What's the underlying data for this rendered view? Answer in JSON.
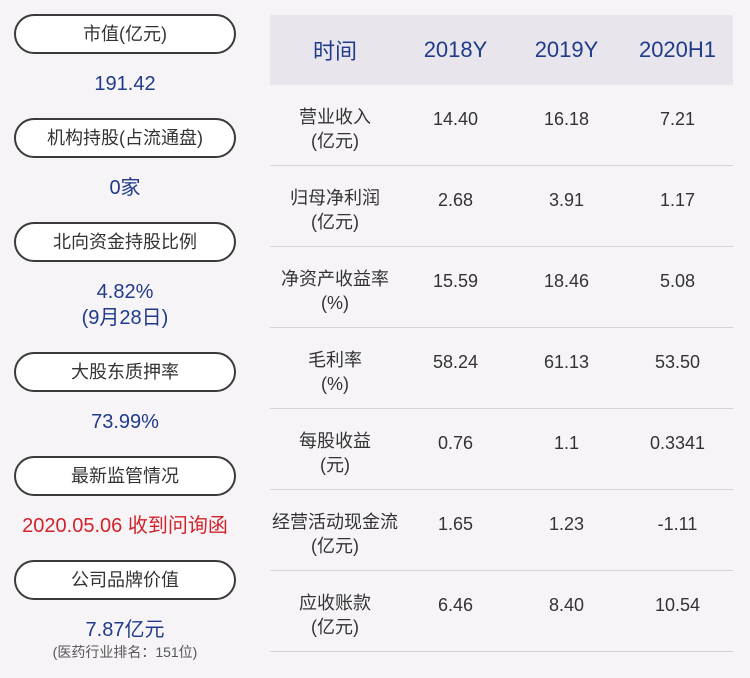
{
  "left": {
    "items": [
      {
        "label": "市值(亿元)",
        "value": "191.42"
      },
      {
        "label": "机构持股(占流通盘)",
        "value": "0家"
      },
      {
        "label": "北向资金持股比例",
        "value_line1": "4.82%",
        "value_line2": "(9月28日)"
      },
      {
        "label": "大股东质押率",
        "value": "73.99%"
      },
      {
        "label": "最新监管情况",
        "value": "2020.05.06 收到问询函"
      },
      {
        "label": "公司品牌价值",
        "value": "7.87亿元",
        "note": "(医药行业排名：151位)"
      }
    ]
  },
  "table": {
    "headers": [
      "时间",
      "2018Y",
      "2019Y",
      "2020H1"
    ],
    "rows": [
      {
        "metric_line1": "营业收入",
        "metric_line2": "(亿元)",
        "values": [
          "14.40",
          "16.18",
          "7.21"
        ]
      },
      {
        "metric_line1": "归母净利润",
        "metric_line2": "(亿元)",
        "values": [
          "2.68",
          "3.91",
          "1.17"
        ]
      },
      {
        "metric_line1": "净资产收益率",
        "metric_line2": "(%)",
        "values": [
          "15.59",
          "18.46",
          "5.08"
        ]
      },
      {
        "metric_line1": "毛利率",
        "metric_line2": "(%)",
        "values": [
          "58.24",
          "61.13",
          "53.50"
        ]
      },
      {
        "metric_line1": "每股收益",
        "metric_line2": "(元)",
        "values": [
          "0.76",
          "1.1",
          "0.3341"
        ]
      },
      {
        "metric_line1": "经营活动现金流",
        "metric_line2": "(亿元)",
        "values": [
          "1.65",
          "1.23",
          "-1.11"
        ]
      },
      {
        "metric_line1": "应收账款",
        "metric_line2": "(亿元)",
        "values": [
          "6.46",
          "8.40",
          "10.54"
        ]
      }
    ]
  }
}
